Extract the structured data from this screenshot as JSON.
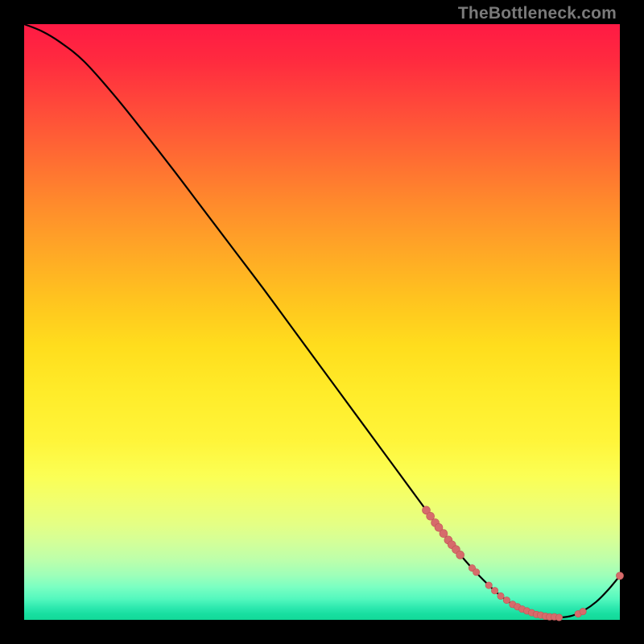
{
  "watermark": "TheBottleneck.com",
  "colors": {
    "gradient_top": "#ff1a44",
    "gradient_mid": "#ffec2a",
    "gradient_bottom": "#13d998",
    "curve": "#000000",
    "points": "#d66b6b",
    "background": "#000000"
  },
  "chart_data": {
    "type": "line",
    "title": "",
    "xlabel": "",
    "ylabel": "",
    "xlim": [
      0,
      100
    ],
    "ylim": [
      0,
      100
    ],
    "grid": false,
    "legend": false,
    "series": [
      {
        "name": "bottleneck-curve",
        "x": [
          0,
          3,
          6,
          10,
          15,
          20,
          25,
          30,
          35,
          40,
          45,
          50,
          55,
          60,
          65,
          70,
          72,
          74,
          76,
          78,
          80,
          82,
          84,
          86,
          88,
          90,
          92,
          94,
          96,
          98,
          100
        ],
        "y": [
          100,
          98.8,
          97.0,
          93.8,
          88.2,
          82.0,
          75.6,
          69.0,
          62.4,
          55.8,
          49.0,
          42.2,
          35.4,
          28.6,
          21.8,
          15.0,
          12.4,
          10.0,
          7.8,
          5.8,
          4.0,
          2.6,
          1.6,
          0.9,
          0.5,
          0.4,
          0.7,
          1.6,
          3.0,
          5.0,
          7.4
        ]
      }
    ],
    "scatter_points": {
      "name": "highlighted-samples",
      "x": [
        67.5,
        68.2,
        69.0,
        69.6,
        70.4,
        71.2,
        71.8,
        72.5,
        73.2,
        75.2,
        75.9,
        78.0,
        79.0,
        80.0,
        81.0,
        82.0,
        82.8,
        83.6,
        84.4,
        85.2,
        86.0,
        86.7,
        87.5,
        88.2,
        89.0,
        89.8,
        93.0,
        93.8,
        100.0
      ],
      "y": [
        18.4,
        17.4,
        16.3,
        15.5,
        14.5,
        13.4,
        12.6,
        11.8,
        10.9,
        8.7,
        8.0,
        5.8,
        4.9,
        4.0,
        3.3,
        2.6,
        2.2,
        1.8,
        1.5,
        1.2,
        0.9,
        0.8,
        0.6,
        0.5,
        0.5,
        0.4,
        1.0,
        1.4,
        7.4
      ],
      "r": [
        5.0,
        5.0,
        5.0,
        5.0,
        5.0,
        5.0,
        5.0,
        5.0,
        5.0,
        4.2,
        4.2,
        4.2,
        4.2,
        4.2,
        4.2,
        4.2,
        4.2,
        4.2,
        4.2,
        4.2,
        4.2,
        4.2,
        4.2,
        4.2,
        4.2,
        4.2,
        4.2,
        4.2,
        4.6
      ]
    }
  }
}
